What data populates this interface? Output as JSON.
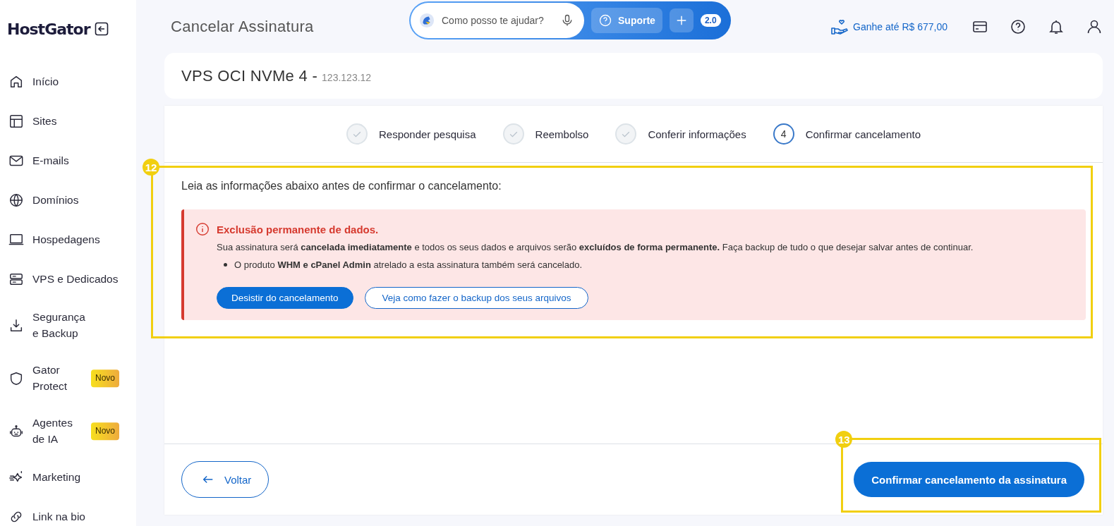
{
  "brand": {
    "name": "HostGator"
  },
  "sidebar": {
    "items": [
      {
        "label": "Início"
      },
      {
        "label": "Sites"
      },
      {
        "label": "E-mails"
      },
      {
        "label": "Domínios"
      },
      {
        "label": "Hospedagens"
      },
      {
        "label": "VPS e Dedicados"
      },
      {
        "label": "Segurança e Backup"
      },
      {
        "label": "Gator Protect",
        "badge": "Novo"
      },
      {
        "label": "Agentes de IA",
        "badge": "Novo"
      },
      {
        "label": "Marketing"
      },
      {
        "label": "Link na bio"
      }
    ]
  },
  "header": {
    "title": "Cancelar Assinatura",
    "search": {
      "placeholder": "Como posso te ajudar?"
    },
    "support": "Suporte",
    "version": "2.0",
    "referral": "Ganhe até R$ 677,00"
  },
  "product": {
    "name": "VPS OCI NVMe 4 -",
    "ip": "123.123.12"
  },
  "steps": [
    {
      "label": "Responder pesquisa",
      "kind": "done"
    },
    {
      "label": "Reembolso",
      "kind": "done"
    },
    {
      "label": "Conferir informações",
      "kind": "done"
    },
    {
      "label": "Confirmar cancelamento",
      "kind": "current",
      "number": "4"
    }
  ],
  "notice": {
    "annotation": "12",
    "intro": "Leia as informações abaixo antes de confirmar o cancelamento:",
    "alert": {
      "title": "Exclusão permanente de dados.",
      "text": "Sua assinatura será **cancelada imediatamente** e todos os seus dados e arquivos serão **excluídos de forma permanente.** Faça backup de tudo o que desejar salvar antes de continuar.",
      "bullets": [
        "O produto **WHM e cPanel Admin** atrelado a esta assinatura também será cancelado."
      ],
      "primary": "Desistir do cancelamento",
      "secondary": "Veja como fazer o backup dos seus arquivos"
    }
  },
  "footer": {
    "back": "Voltar",
    "confirm": "Confirmar cancelamento da assinatura",
    "annotation": "13"
  }
}
